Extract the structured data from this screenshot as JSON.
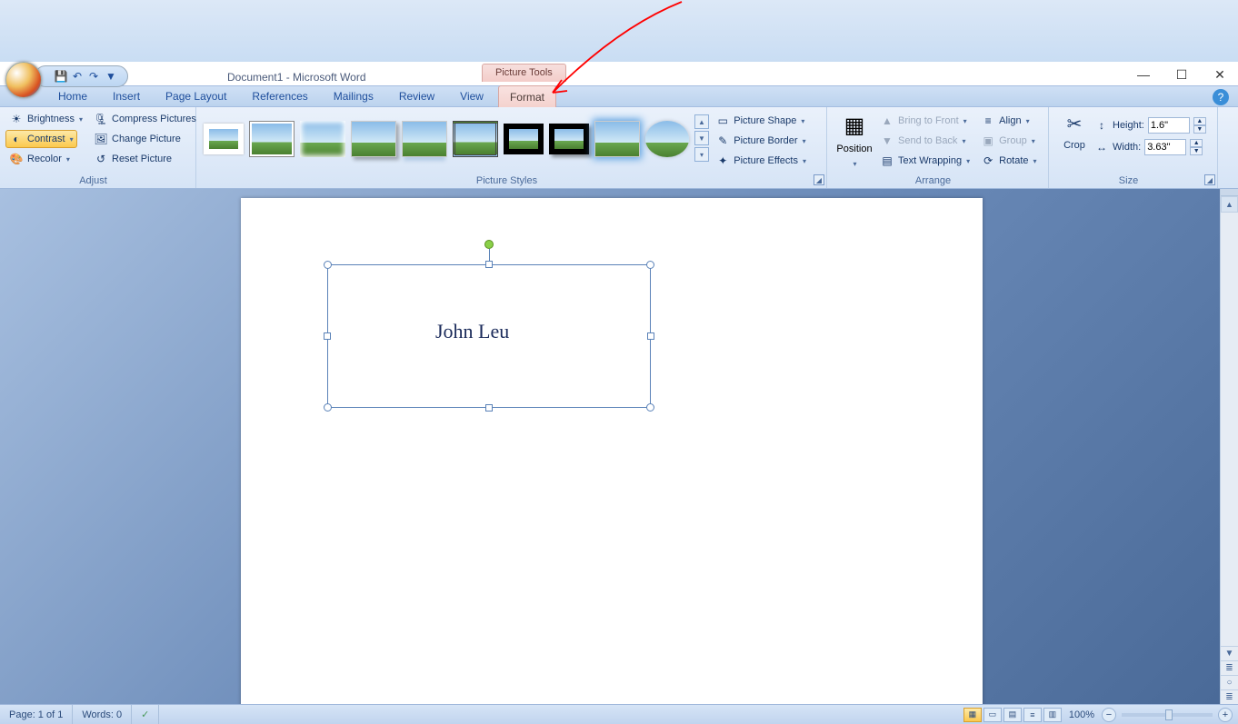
{
  "title": "Document1 - Microsoft Word",
  "context_tab": "Picture Tools",
  "tabs": [
    "Home",
    "Insert",
    "Page Layout",
    "References",
    "Mailings",
    "Review",
    "View",
    "Format"
  ],
  "active_tab_index": 7,
  "qat": {
    "save": "💾",
    "undo": "↶",
    "redo": "↷"
  },
  "win": {
    "min": "—",
    "max": "☐",
    "close": "✕"
  },
  "help": "?",
  "ribbon": {
    "adjust": {
      "label": "Adjust",
      "brightness": "Brightness",
      "contrast": "Contrast",
      "recolor": "Recolor",
      "compress": "Compress Pictures",
      "change": "Change Picture",
      "reset": "Reset Picture"
    },
    "pstyles": {
      "label": "Picture Styles",
      "shape": "Picture Shape",
      "border": "Picture Border",
      "effects": "Picture Effects"
    },
    "arrange": {
      "label": "Arrange",
      "position": "Position",
      "front": "Bring to Front",
      "back": "Send to Back",
      "wrap": "Text Wrapping",
      "align": "Align",
      "group": "Group",
      "rotate": "Rotate"
    },
    "size": {
      "label": "Size",
      "crop": "Crop",
      "height_label": "Height:",
      "width_label": "Width:",
      "height": "1.6\"",
      "width": "3.63\""
    }
  },
  "document": {
    "signature_text": "John Leu"
  },
  "status": {
    "page": "Page: 1 of 1",
    "words": "Words: 0",
    "zoom": "100%"
  }
}
